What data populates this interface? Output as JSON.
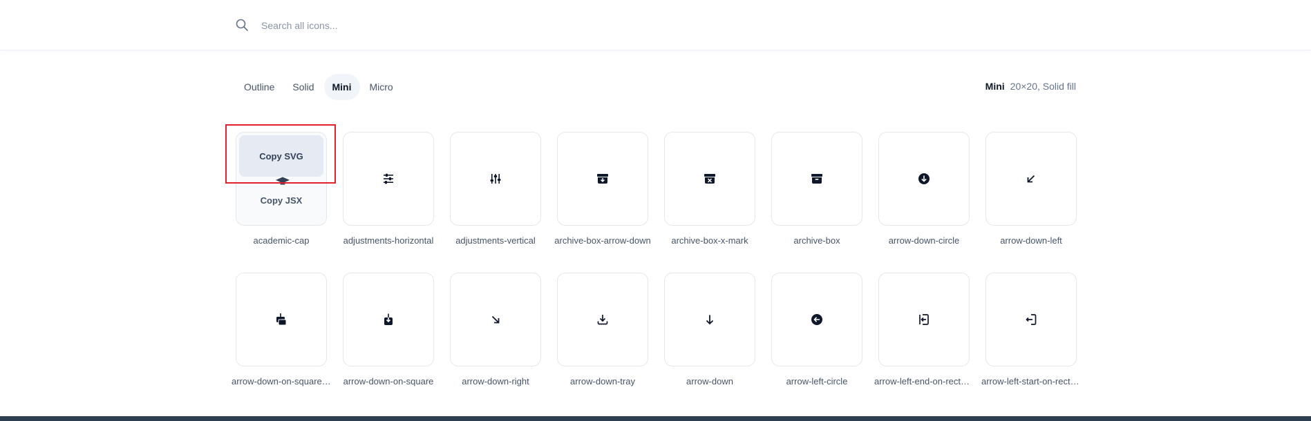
{
  "search": {
    "placeholder": "Search all icons..."
  },
  "tabs": [
    {
      "label": "Outline",
      "active": false
    },
    {
      "label": "Solid",
      "active": false
    },
    {
      "label": "Mini",
      "active": true
    },
    {
      "label": "Micro",
      "active": false
    }
  ],
  "style_info": {
    "name": "Mini",
    "description": "20×20, Solid fill"
  },
  "hover_card": {
    "copy_svg": "Copy SVG",
    "copy_jsx": "Copy JSX"
  },
  "icons": [
    {
      "label": "academic-cap",
      "icon": "academic-cap-icon"
    },
    {
      "label": "adjustments-horizontal",
      "icon": "adjustments-horizontal-icon"
    },
    {
      "label": "adjustments-vertical",
      "icon": "adjustments-vertical-icon"
    },
    {
      "label": "archive-box-arrow-down",
      "icon": "archive-box-arrow-down-icon"
    },
    {
      "label": "archive-box-x-mark",
      "icon": "archive-box-x-mark-icon"
    },
    {
      "label": "archive-box",
      "icon": "archive-box-icon"
    },
    {
      "label": "arrow-down-circle",
      "icon": "arrow-down-circle-icon"
    },
    {
      "label": "arrow-down-left",
      "icon": "arrow-down-left-icon"
    },
    {
      "label": "arrow-down-on-square-stack",
      "icon": "arrow-down-on-square-stack-icon"
    },
    {
      "label": "arrow-down-on-square",
      "icon": "arrow-down-on-square-icon"
    },
    {
      "label": "arrow-down-right",
      "icon": "arrow-down-right-icon"
    },
    {
      "label": "arrow-down-tray",
      "icon": "arrow-down-tray-icon"
    },
    {
      "label": "arrow-down",
      "icon": "arrow-down-icon"
    },
    {
      "label": "arrow-left-circle",
      "icon": "arrow-left-circle-icon"
    },
    {
      "label": "arrow-left-end-on-rectangle",
      "icon": "arrow-left-end-on-rectangle-icon"
    },
    {
      "label": "arrow-left-start-on-rectangle",
      "icon": "arrow-left-start-on-rectangle-icon"
    }
  ],
  "colors": {
    "accent_highlight": "#e0202a",
    "icon_fill": "#0f172a",
    "text_muted": "#475569"
  }
}
